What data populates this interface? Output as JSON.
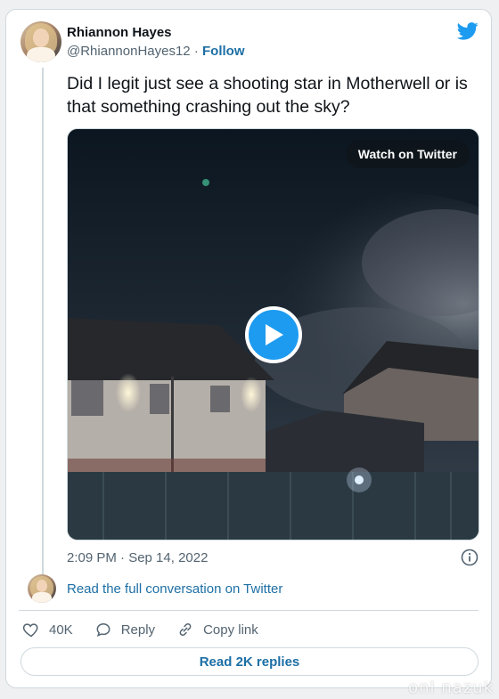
{
  "author": {
    "name": "Rhiannon Hayes",
    "handle": "@RhiannonHayes12",
    "separator": " · ",
    "follow_label": "Follow"
  },
  "tweet": {
    "text": "Did I legit just see a shooting star in Motherwell or is that something crashing out the sky?",
    "timestamp": "2:09 PM · Sep 14, 2022"
  },
  "media": {
    "watch_label": "Watch on Twitter",
    "play_icon": "play-icon"
  },
  "conversation": {
    "link_label": "Read the full conversation on Twitter"
  },
  "actions": {
    "likes_count": "40K",
    "reply_label": "Reply",
    "copy_label": "Copy link"
  },
  "replies_button": "Read 2K replies",
  "watermark": "onl nazuk",
  "colors": {
    "link": "#1d6fa5",
    "twitter_blue": "#1d9bf0",
    "muted_text": "#536471",
    "border": "#cfd9de"
  },
  "icons": [
    "twitter-bird-icon",
    "info-icon",
    "heart-icon",
    "reply-bubble-icon",
    "link-icon",
    "play-icon"
  ]
}
